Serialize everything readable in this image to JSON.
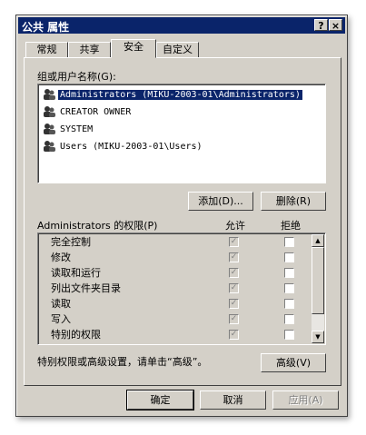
{
  "window": {
    "title": "公共 属性",
    "help_label": "?",
    "close_label": "×"
  },
  "tabs": [
    {
      "label": "常规"
    },
    {
      "label": "共享"
    },
    {
      "label": "安全"
    },
    {
      "label": "自定义"
    }
  ],
  "security": {
    "group_label": "组或用户名称(G):",
    "users": [
      {
        "name": "Administrators (MIKU-2003-01\\Administrators)",
        "selected": true
      },
      {
        "name": "CREATOR OWNER",
        "selected": false
      },
      {
        "name": "SYSTEM",
        "selected": false
      },
      {
        "name": "Users (MIKU-2003-01\\Users)",
        "selected": false
      }
    ],
    "add_label": "添加(D)...",
    "remove_label": "删除(R)",
    "permissions_label": "Administrators 的权限(P)",
    "allow_header": "允许",
    "deny_header": "拒绝",
    "permissions": [
      {
        "name": "完全控制",
        "allow": true,
        "deny": false
      },
      {
        "name": "修改",
        "allow": true,
        "deny": false
      },
      {
        "name": "读取和运行",
        "allow": true,
        "deny": false
      },
      {
        "name": "列出文件夹目录",
        "allow": true,
        "deny": false
      },
      {
        "name": "读取",
        "allow": true,
        "deny": false
      },
      {
        "name": "写入",
        "allow": true,
        "deny": false
      },
      {
        "name": "特别的权限",
        "allow": true,
        "deny": false
      }
    ],
    "advanced_hint": "特别权限或高级设置，请单击“高级”。",
    "advanced_label": "高级(V)"
  },
  "footer": {
    "ok_label": "确定",
    "cancel_label": "取消",
    "apply_label": "应用(A)"
  }
}
